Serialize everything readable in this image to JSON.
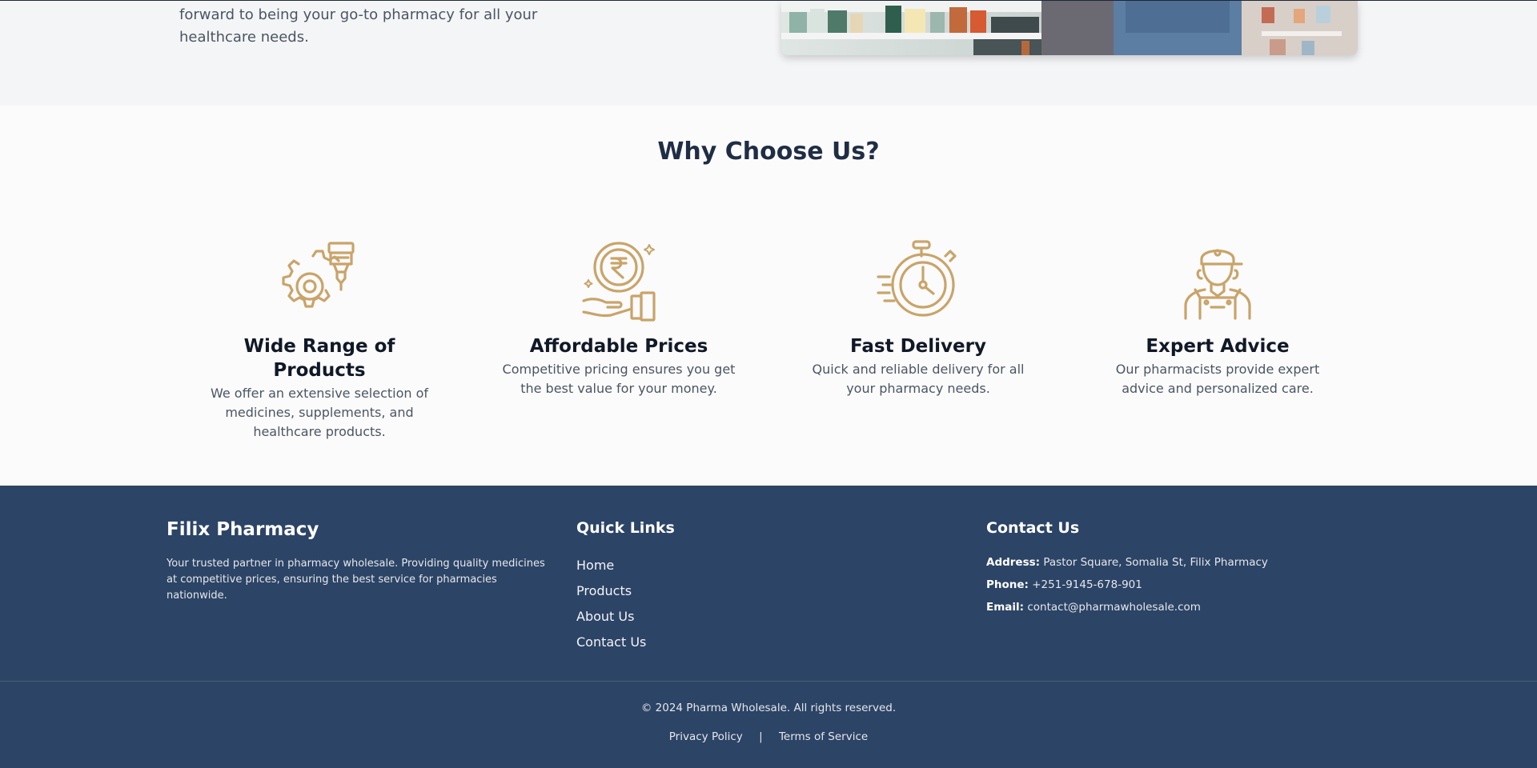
{
  "about": {
    "text": "forward to being your go-to pharmacy for all your healthcare needs."
  },
  "features": {
    "title": "Why Choose Us?",
    "items": [
      {
        "icon": "gear-product-icon",
        "title": "Wide Range of Products",
        "desc": "We offer an extensive selection of medicines, supplements, and healthcare products."
      },
      {
        "icon": "rupee-hand-icon",
        "title": "Affordable Prices",
        "desc": "Competitive pricing ensures you get the best value for your money."
      },
      {
        "icon": "stopwatch-icon",
        "title": "Fast Delivery",
        "desc": "Quick and reliable delivery for all your pharmacy needs."
      },
      {
        "icon": "pharmacist-icon",
        "title": "Expert Advice",
        "desc": "Our pharmacists provide expert advice and personalized care."
      }
    ],
    "icon_color": "#c9a46a"
  },
  "footer": {
    "brand": "Filix Pharmacy",
    "about": "Your trusted partner in pharmacy wholesale. Providing quality medicines at competitive prices, ensuring the best service for pharmacies nationwide.",
    "quick_links_title": "Quick Links",
    "quick_links": [
      "Home",
      "Products",
      "About Us",
      "Contact Us"
    ],
    "contact_title": "Contact Us",
    "contact": {
      "address_label": "Address:",
      "address": "Pastor Square, Somalia St, Filix Pharmacy",
      "phone_label": "Phone:",
      "phone": "+251-9145-678-901",
      "email_label": "Email:",
      "email": "contact@pharmawholesale.com"
    },
    "copyright": "© 2024 Pharma Wholesale. All rights reserved.",
    "privacy": "Privacy Policy",
    "separator": "|",
    "terms": "Terms of Service",
    "background": "#2c4466"
  }
}
